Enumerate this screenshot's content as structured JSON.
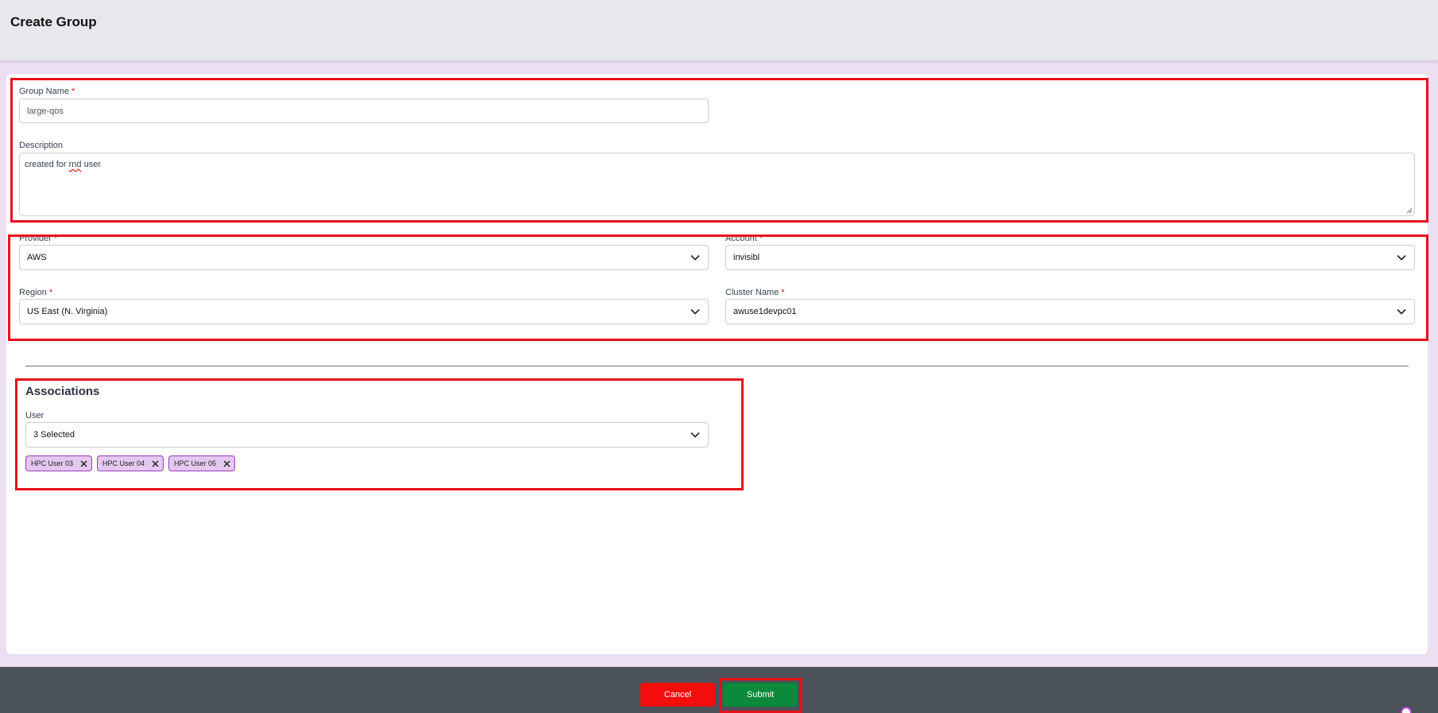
{
  "header": {
    "title": "Create Group"
  },
  "form": {
    "group_name": {
      "label": "Group Name",
      "required_mark": "*",
      "value": "large-qos"
    },
    "description": {
      "label": "Description",
      "value_prefix": "created for ",
      "value_misspelled": "rnd",
      "value_suffix": " user"
    },
    "provider": {
      "label": "Provider",
      "required_mark": "*",
      "value": "AWS"
    },
    "account": {
      "label": "Account",
      "required_mark": "*",
      "value": "invisibl"
    },
    "region": {
      "label": "Region",
      "required_mark": "*",
      "value": "US East (N. Virginia)"
    },
    "cluster_name": {
      "label": "Cluster Name",
      "required_mark": "*",
      "value": "awuse1devpc01"
    }
  },
  "associations": {
    "title": "Associations",
    "user_label": "User",
    "user_select_value": "3 Selected",
    "chips": [
      "HPC User 03",
      "HPC User 04",
      "HPC User 05"
    ]
  },
  "footer": {
    "cancel_label": "Cancel",
    "submit_label": "Submit"
  },
  "colors": {
    "highlight": "#e8101a",
    "cancel": "#f30d0d",
    "submit": "#0a8a3a",
    "chip_bg": "#e4c8f0",
    "chip_border": "#9b3bb8",
    "page_bg": "#ebdff1",
    "footer_bg": "#4a5159"
  },
  "icons": {
    "select_arrow": "chevron-down-icon",
    "chip_remove": "close-icon",
    "resize": "resize-grip-icon",
    "help": "help-icon"
  }
}
